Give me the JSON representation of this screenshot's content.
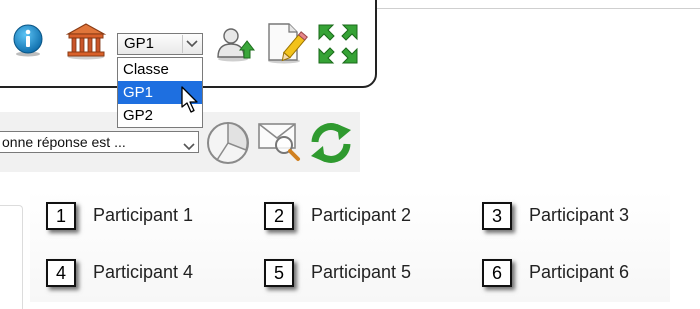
{
  "toolbar": {
    "icons": {
      "info": "info-icon",
      "institution": "institution-building-icon",
      "user_upload": "user-upload-icon",
      "edit_document": "edit-document-icon",
      "fullscreen": "fullscreen-icon"
    },
    "group_select": {
      "value": "GP1",
      "options": [
        "Classe",
        "GP1",
        "GP2"
      ],
      "highlighted": "GP1"
    }
  },
  "question_toolbar": {
    "answer_select_value": "onne réponse est ...",
    "icons": {
      "chart": "pie-chart-icon",
      "mail_search": "mail-search-icon",
      "refresh": "refresh-icon"
    }
  },
  "participants": [
    {
      "number": "1",
      "name": "Participant 1"
    },
    {
      "number": "2",
      "name": "Participant 2"
    },
    {
      "number": "3",
      "name": "Participant 3"
    },
    {
      "number": "4",
      "name": "Participant 4"
    },
    {
      "number": "5",
      "name": "Participant 5"
    },
    {
      "number": "6",
      "name": "Participant 6"
    }
  ],
  "colors": {
    "selected_option_bg": "#1e6fe0",
    "info_blue": "#1a7fd0",
    "green_arrows": "#2f9a2f"
  }
}
